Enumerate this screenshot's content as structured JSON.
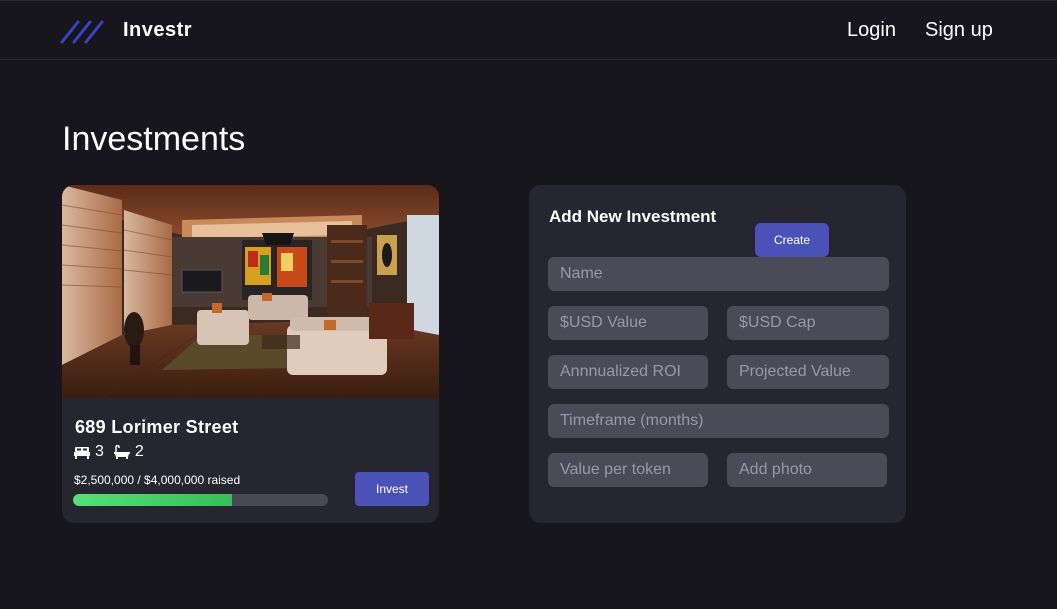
{
  "nav": {
    "brand": "Investr",
    "login": "Login",
    "signup": "Sign up",
    "logo_color": "#3a42c4"
  },
  "page": {
    "title": "Investments"
  },
  "property": {
    "name": "689 Lorimer Street",
    "beds": "3",
    "baths": "2",
    "raised_text": "$2,500,000 / $4,000,000 raised",
    "raised_fraction": 0.625,
    "invest_label": "Invest",
    "photo_icon": "living-room-photo"
  },
  "form": {
    "title": "Add New Investment",
    "create_label": "Create",
    "name_placeholder": "Name",
    "usd_value_placeholder": "$USD Value",
    "usd_cap_placeholder": "$USD Cap",
    "roi_placeholder": "Annnualized ROI",
    "projected_placeholder": "Projected Value",
    "timeframe_placeholder": "Timeframe (months)",
    "token_value_placeholder": "Value per token",
    "add_photo_label": "Add photo"
  },
  "colors": {
    "background": "#16161c",
    "card": "#262630",
    "accent": "#4a52b8",
    "progress": "#56e07a"
  }
}
